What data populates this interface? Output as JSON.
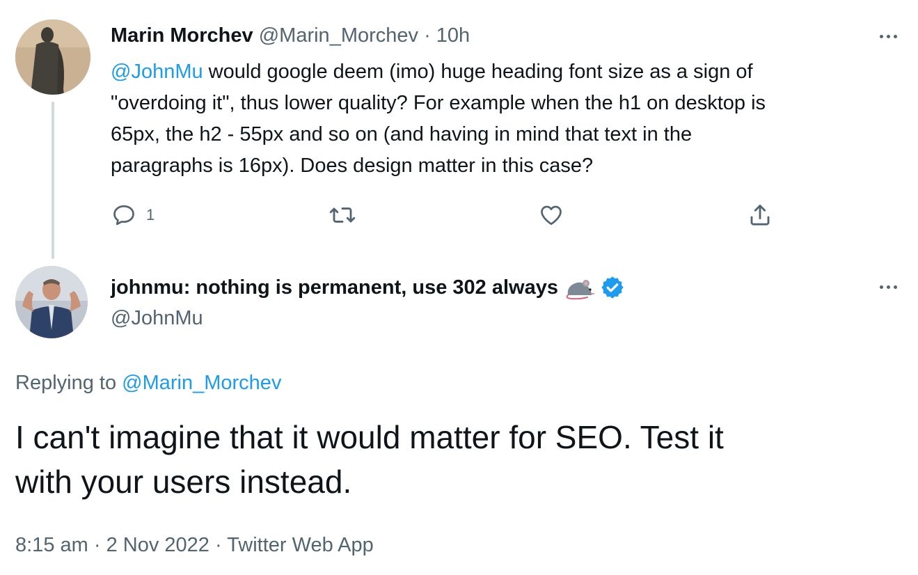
{
  "parent_tweet": {
    "author_name": "Marin Morchev",
    "author_handle": "@Marin_Morchev",
    "separator": " · ",
    "time": "10h",
    "text_lines": [
      {
        "mention": "@JohnMu",
        "rest": " would google deem (imo) huge heading font size as a sign of"
      },
      {
        "mention": "",
        "rest": "\"overdoing it\", thus lower quality? For example when the h1 on desktop is"
      },
      {
        "mention": "",
        "rest": "65px, the h2 - 55px and so on (and having in mind that text in the"
      },
      {
        "mention": "",
        "rest": "paragraphs is 16px). Does design matter in this case?"
      }
    ],
    "reply_count": "1",
    "actions": {
      "reply_icon": "reply-icon",
      "retweet_icon": "retweet-icon",
      "like_icon": "heart-icon",
      "share_icon": "share-icon"
    }
  },
  "reply_tweet": {
    "author_name": "johnmu: nothing is permanent, use 302 always",
    "author_handle": "@JohnMu",
    "emoji_icon": "rat-icon",
    "verified_icon": "verified-badge-icon",
    "replying_prefix": "Replying to ",
    "replying_to": "@Marin_Morchev",
    "text_lines": [
      "I can't imagine that it would matter for SEO. Test it",
      "with your users instead."
    ],
    "time": "8:15 am",
    "separator": " · ",
    "date": "2 Nov 2022",
    "source": "Twitter Web App"
  },
  "colors": {
    "link": "#1d9bf0",
    "muted": "#536471",
    "text": "#0f1419",
    "thread_line": "#cfd9de"
  }
}
